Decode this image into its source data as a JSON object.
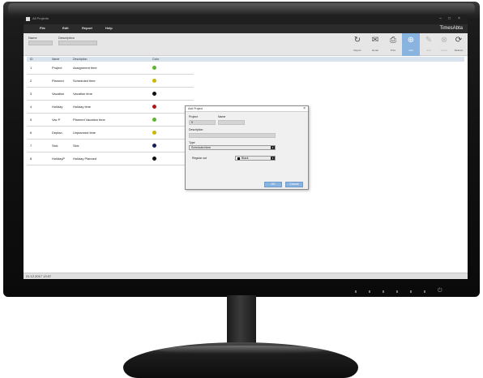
{
  "window": {
    "title": "All Projects",
    "controls": [
      "–",
      "□",
      "×"
    ]
  },
  "menu": {
    "items": [
      "File",
      "Edit",
      "Report",
      "Help"
    ],
    "brand": "TimesAbta"
  },
  "filters": {
    "name_label": "Name",
    "description_label": "Description"
  },
  "toolbar": {
    "buttons": [
      {
        "label": "Report",
        "icon": "share-icon",
        "state": "normal"
      },
      {
        "label": "Email",
        "icon": "envelope-icon",
        "state": "normal"
      },
      {
        "label": "Print",
        "icon": "printer-icon",
        "state": "normal"
      },
      {
        "label": "Add",
        "icon": "plus-circle-icon",
        "state": "active"
      },
      {
        "label": "Edit",
        "icon": "pencil-icon",
        "state": "disabled"
      },
      {
        "label": "Delete",
        "icon": "x-circle-icon",
        "state": "disabled"
      },
      {
        "label": "Refresh",
        "icon": "refresh-icon",
        "state": "normal"
      }
    ]
  },
  "table": {
    "headers": [
      "ID",
      "Name",
      "Description",
      "Color"
    ],
    "rows": [
      {
        "id": "1",
        "name": "Project",
        "description": "Assignment time",
        "color": "#5cb82a"
      },
      {
        "id": "2",
        "name": "Planned",
        "description": "Scheduled time",
        "color": "#c9b800"
      },
      {
        "id": "3",
        "name": "Vacation",
        "description": "Vacation time",
        "color": "#111111"
      },
      {
        "id": "4",
        "name": "Holiday",
        "description": "Holiday time",
        "color": "#b0191c"
      },
      {
        "id": "5",
        "name": "Vac P",
        "description": "Planned Vacation time",
        "color": "#5cb82a"
      },
      {
        "id": "6",
        "name": "Deplan",
        "description": "Unplanned time",
        "color": "#c9b800"
      },
      {
        "id": "7",
        "name": "Sick",
        "description": "Sick",
        "color": "#1a1f5c"
      },
      {
        "id": "8",
        "name": "HolidayP",
        "description": "Holiday Planned",
        "color": "#111111"
      }
    ]
  },
  "dialog": {
    "title": "Add Project",
    "close": "×",
    "project_label": "Project",
    "project_value": "9",
    "name_label": "Name",
    "description_label": "Description",
    "type_label": "Type",
    "type_value": "Scheduled time",
    "regular_out_label": "Regular out",
    "color_value": "Black",
    "ok_label": "OK",
    "cancel_label": "Cancel"
  },
  "status": {
    "text": "21.12.2017 13:07"
  },
  "colors": {
    "accent": "#8ab4e0",
    "menubar": "#2b2b2b",
    "titlebar": "#1f1f1f"
  }
}
